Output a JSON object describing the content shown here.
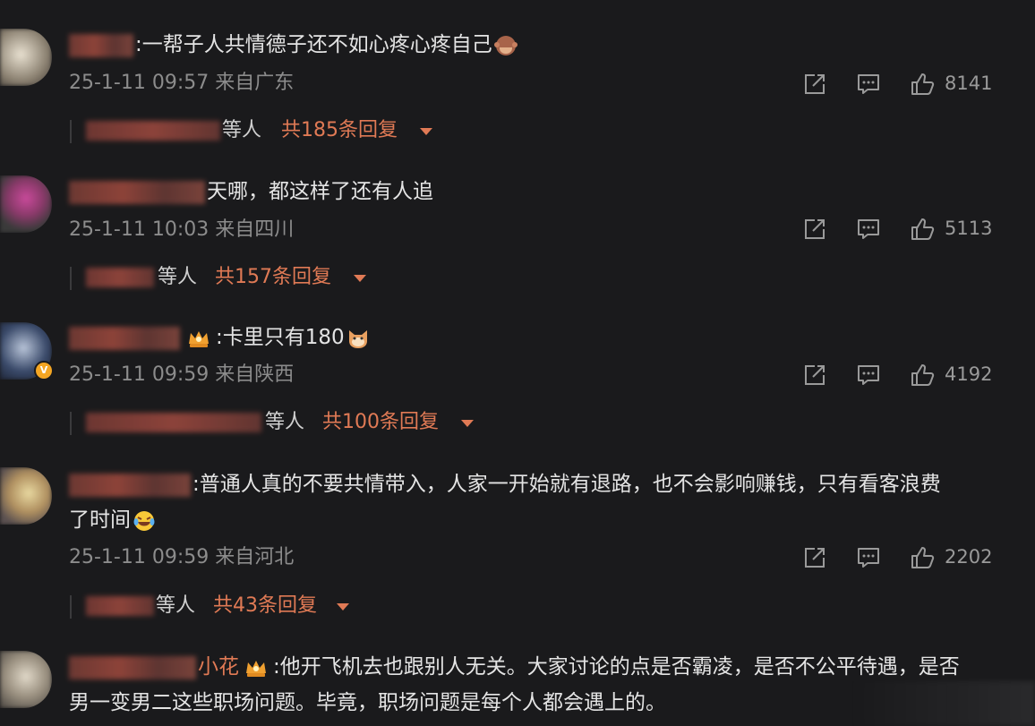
{
  "comments": [
    {
      "text": ":一帮子人共情德子还不如心疼心疼自己",
      "time": "25-1-11 09:57",
      "location": "来自广东",
      "likes": "8141",
      "replies_etc": "等人",
      "replies_total": "共185条回复",
      "emoji": "monkey-covering-eyes"
    },
    {
      "text": "天哪，都这样了还有人追",
      "time": "25-1-11 10:03",
      "location": "来自四川",
      "likes": "5113",
      "replies_etc": "等人",
      "replies_total": "共157条回复"
    },
    {
      "text": ":卡里只有180",
      "time": "25-1-11 09:59",
      "location": "来自陕西",
      "likes": "4192",
      "replies_etc": "等人",
      "replies_total": "共100条回复",
      "emoji": "cat-face"
    },
    {
      "text_line1": ":普通人真的不要共情带入，人家一开始就有退路，也不会影响赚钱，只有看客浪费",
      "text_line2": "了时间",
      "time": "25-1-11 09:59",
      "location": "来自河北",
      "likes": "2202",
      "replies_etc": "等人",
      "replies_total": "共43条回复",
      "emoji": "laughing-crying-face"
    },
    {
      "name_visible": "小花",
      "text_line1": ":他开飞机去也跟别人无关。大家讨论的点是否霸凌，是否不公平待遇，是否",
      "text_line2": "男一变男二这些职场问题。毕竟，职场问题是每个人都会遇上的。"
    }
  ],
  "icons": {
    "share": "share-icon",
    "comment": "comment-icon",
    "like": "thumbs-up-icon",
    "expand": "caret-down-icon",
    "member": "crown-icon",
    "verified": "verified-badge-icon"
  },
  "colors": {
    "background": "#1a1a1c",
    "accent": "#e07a55",
    "meta": "#8c8c8c",
    "text": "#e4e4e4"
  }
}
